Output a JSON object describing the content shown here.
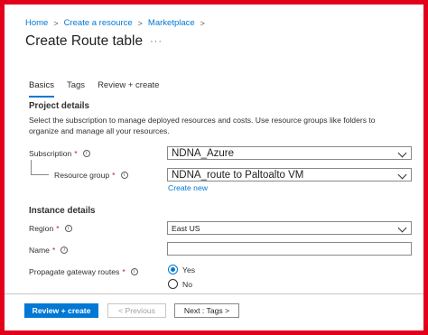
{
  "breadcrumb": {
    "items": [
      "Home",
      "Create a resource",
      "Marketplace"
    ],
    "separator": ">",
    "trailing_separator": ">"
  },
  "header": {
    "title": "Create Route table",
    "more_icon": "ellipsis-icon",
    "more_text": "···"
  },
  "tabs": [
    "Basics",
    "Tags",
    "Review + create"
  ],
  "active_tab": "Basics",
  "project": {
    "heading": "Project details",
    "description": "Select the subscription to manage deployed resources and costs. Use resource groups like folders to organize and manage all your resources.",
    "subscription_label": "Subscription",
    "subscription_value": "NDNA_Azure",
    "resource_group_label": "Resource group",
    "resource_group_value": "NDNA_route to Paltoalto VM",
    "create_new_label": "Create new"
  },
  "instance": {
    "heading": "Instance details",
    "region_label": "Region",
    "region_value": "East US",
    "name_label": "Name",
    "name_value": "",
    "propagate_label": "Propagate gateway routes",
    "options": [
      "Yes",
      "No"
    ],
    "selected_option": "Yes"
  },
  "required_marker": "*",
  "info_icon_glyph": "i",
  "footer": {
    "review_create_label": "Review + create",
    "previous_label": "< Previous",
    "next_label": "Next : Tags >"
  },
  "colors": {
    "frame": "#e3001b",
    "accent": "#0078d4",
    "required": "#a4262c"
  }
}
